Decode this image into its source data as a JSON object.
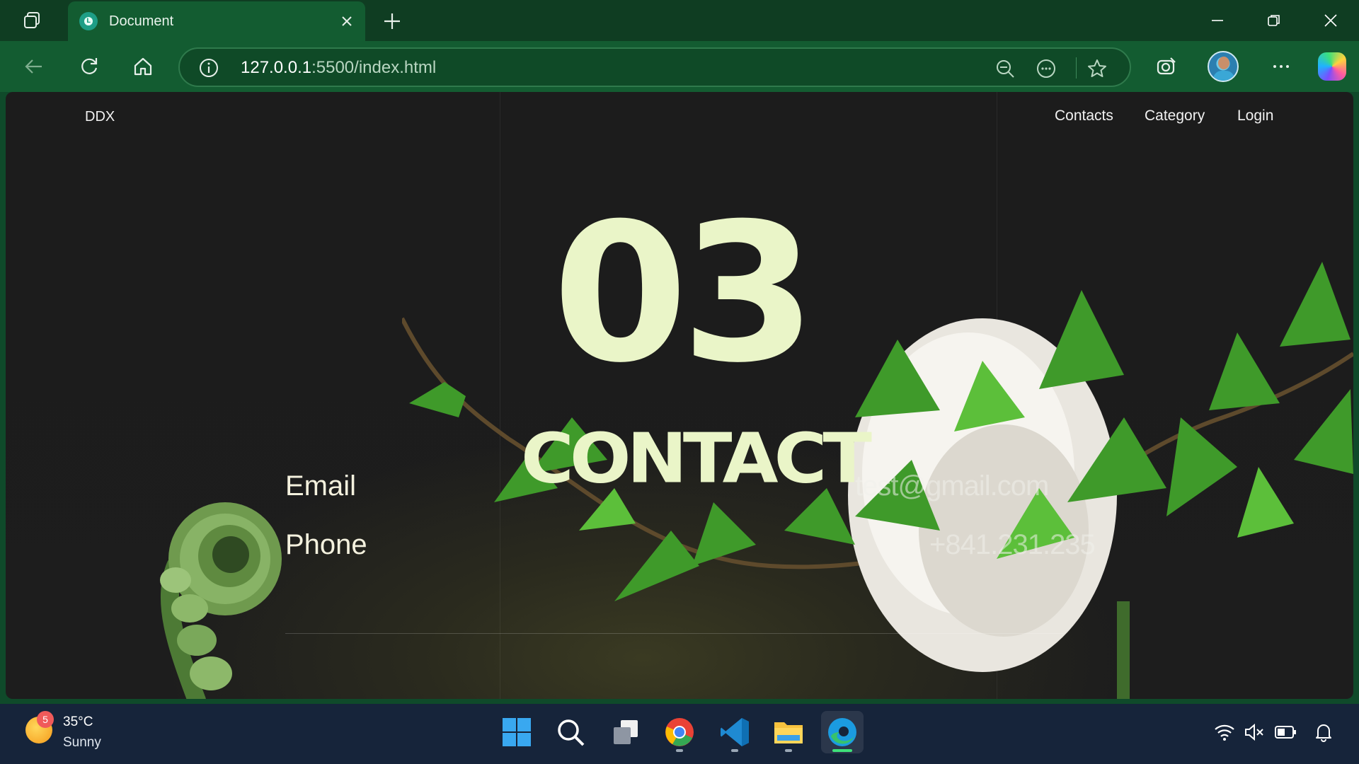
{
  "browser": {
    "tab": {
      "title": "Document",
      "favicon_letter": "L"
    },
    "address": {
      "host": "127.0.0.1",
      "path": ":5500/index.html"
    }
  },
  "page": {
    "brand": "DDX",
    "nav": [
      "Contacts",
      "Category",
      "Login"
    ],
    "hero_number": "03",
    "hero_title": "CONTACT",
    "rows": [
      {
        "label": "Email",
        "value": "test@gmail.com"
      },
      {
        "label": "Phone",
        "value": "+841.231.235"
      }
    ]
  },
  "taskbar": {
    "weather": {
      "badge": "5",
      "temperature": "35°C",
      "condition": "Sunny"
    },
    "apps": [
      "start-icon",
      "search-icon",
      "task-view-icon",
      "chrome-icon",
      "vscode-icon",
      "file-explorer-icon",
      "edge-icon"
    ]
  },
  "colors": {
    "chrome_dark": "#0f3d22",
    "chrome": "#135c31",
    "page_bg": "#1c1c1c",
    "hero": "#eaf5c8",
    "taskbar": "#16243a"
  }
}
